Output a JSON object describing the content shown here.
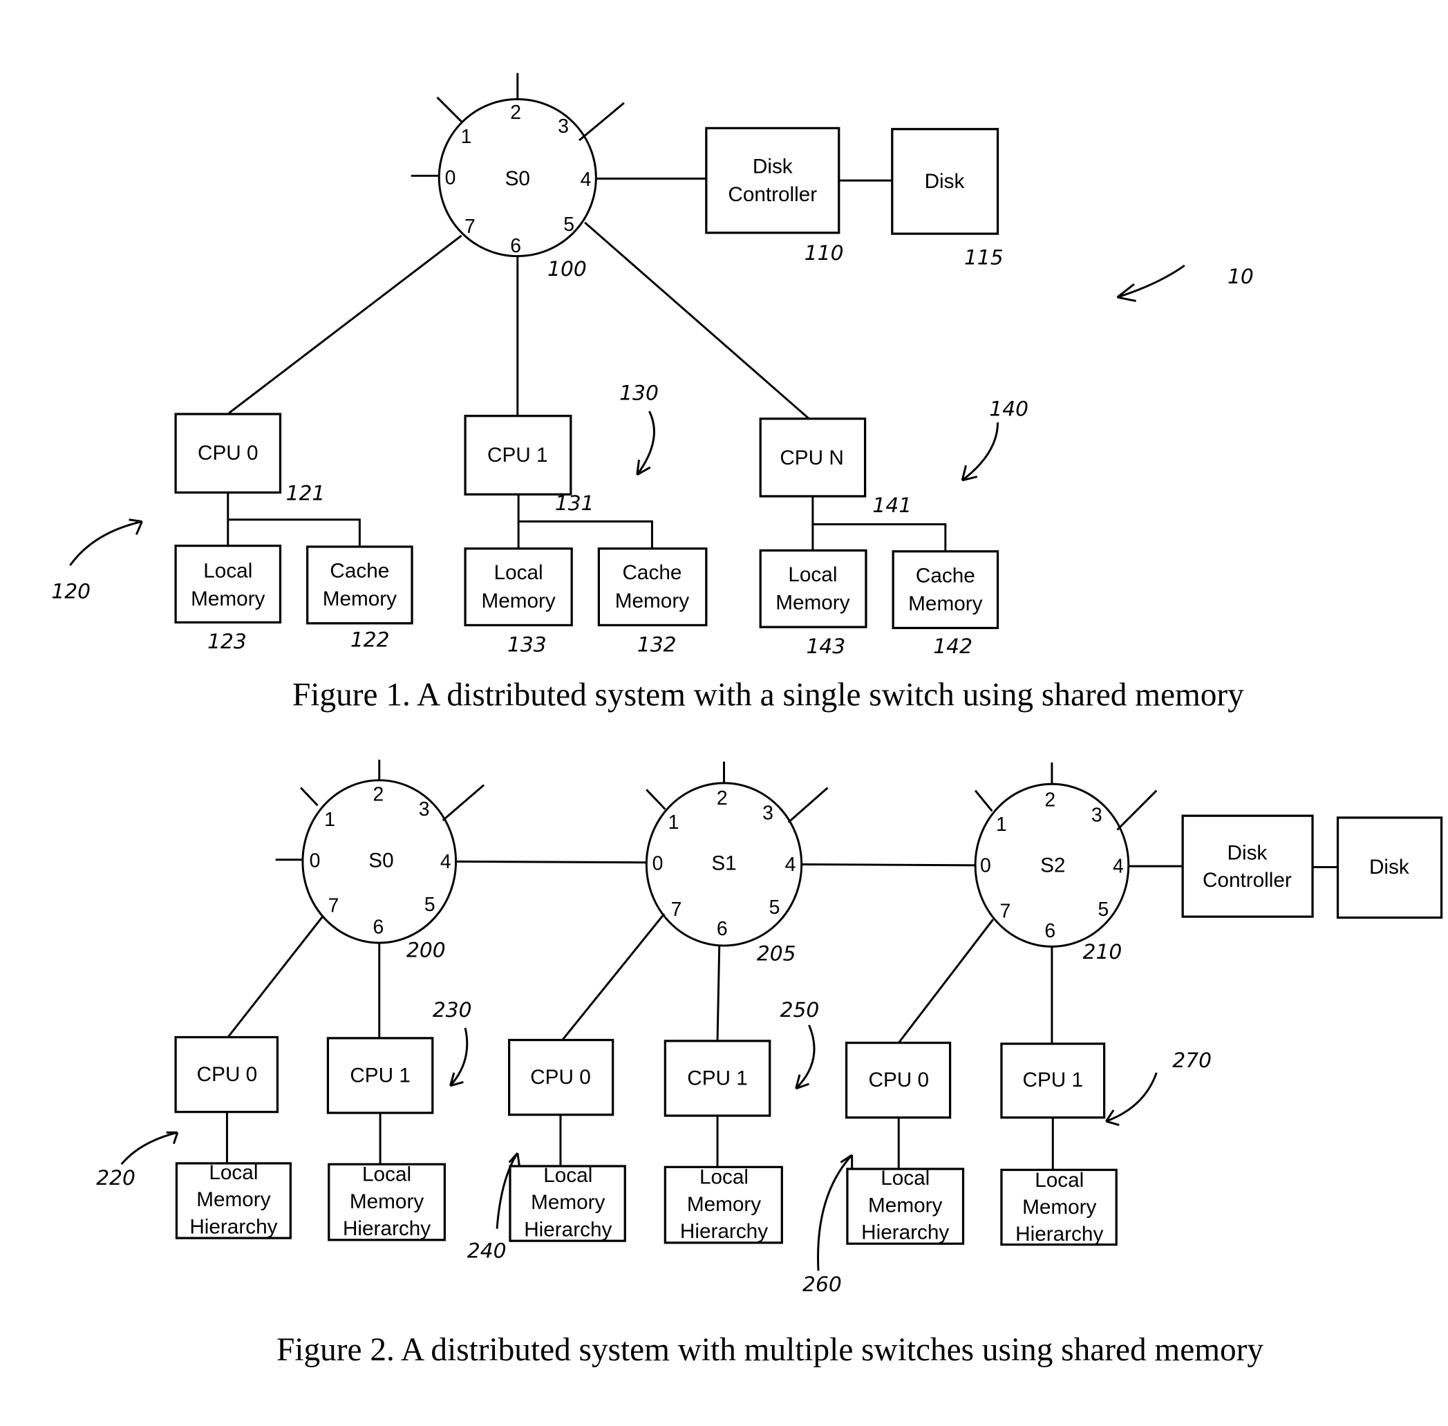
{
  "figure1": {
    "caption": "Figure 1. A distributed system with a single switch using shared memory",
    "system_ref": "10",
    "switch": {
      "label": "S0",
      "ref": "100",
      "ports": [
        "0",
        "1",
        "2",
        "3",
        "4",
        "5",
        "6",
        "7"
      ]
    },
    "disk_controller": {
      "line1": "Disk",
      "line2": "Controller",
      "ref": "110"
    },
    "disk": {
      "label": "Disk",
      "ref": "115"
    },
    "nodes": [
      {
        "ref": "120",
        "cpu": "CPU 0",
        "cpu_ref": "121",
        "local_l1": "Local",
        "local_l2": "Memory",
        "local_ref": "123",
        "cache_l1": "Cache",
        "cache_l2": "Memory",
        "cache_ref": "122"
      },
      {
        "ref": "130",
        "cpu": "CPU 1",
        "cpu_ref": "131",
        "local_l1": "Local",
        "local_l2": "Memory",
        "local_ref": "133",
        "cache_l1": "Cache",
        "cache_l2": "Memory",
        "cache_ref": "132"
      },
      {
        "ref": "140",
        "cpu": "CPU N",
        "cpu_ref": "141",
        "local_l1": "Local",
        "local_l2": "Memory",
        "local_ref": "143",
        "cache_l1": "Cache",
        "cache_l2": "Memory",
        "cache_ref": "142"
      }
    ]
  },
  "figure2": {
    "caption": "Figure 2. A distributed system with multiple switches using shared memory",
    "switches": [
      {
        "label": "S0",
        "ref": "200"
      },
      {
        "label": "S1",
        "ref": "205"
      },
      {
        "label": "S2",
        "ref": "210"
      }
    ],
    "ports": [
      "0",
      "1",
      "2",
      "3",
      "4",
      "5",
      "6",
      "7"
    ],
    "disk_controller": {
      "line1": "Disk",
      "line2": "Controller"
    },
    "disk": {
      "label": "Disk"
    },
    "cpus": [
      {
        "label": "CPU 0",
        "mem_l1": "Local",
        "mem_l2": "Memory",
        "mem_l3": "Hierarchy"
      },
      {
        "label": "CPU 1",
        "mem_l1": "Local",
        "mem_l2": "Memory",
        "mem_l3": "Hierarchy"
      },
      {
        "label": "CPU 0",
        "mem_l1": "Local",
        "mem_l2": "Memory",
        "mem_l3": "Hierarchy"
      },
      {
        "label": "CPU 1",
        "mem_l1": "Local",
        "mem_l2": "Memory",
        "mem_l3": "Hierarchy"
      },
      {
        "label": "CPU 0",
        "mem_l1": "Local",
        "mem_l2": "Memory",
        "mem_l3": "Hierarchy"
      },
      {
        "label": "CPU 1",
        "mem_l1": "Local",
        "mem_l2": "Memory",
        "mem_l3": "Hierarchy"
      }
    ],
    "node_refs": [
      "220",
      "230",
      "240",
      "250",
      "260",
      "270"
    ]
  }
}
